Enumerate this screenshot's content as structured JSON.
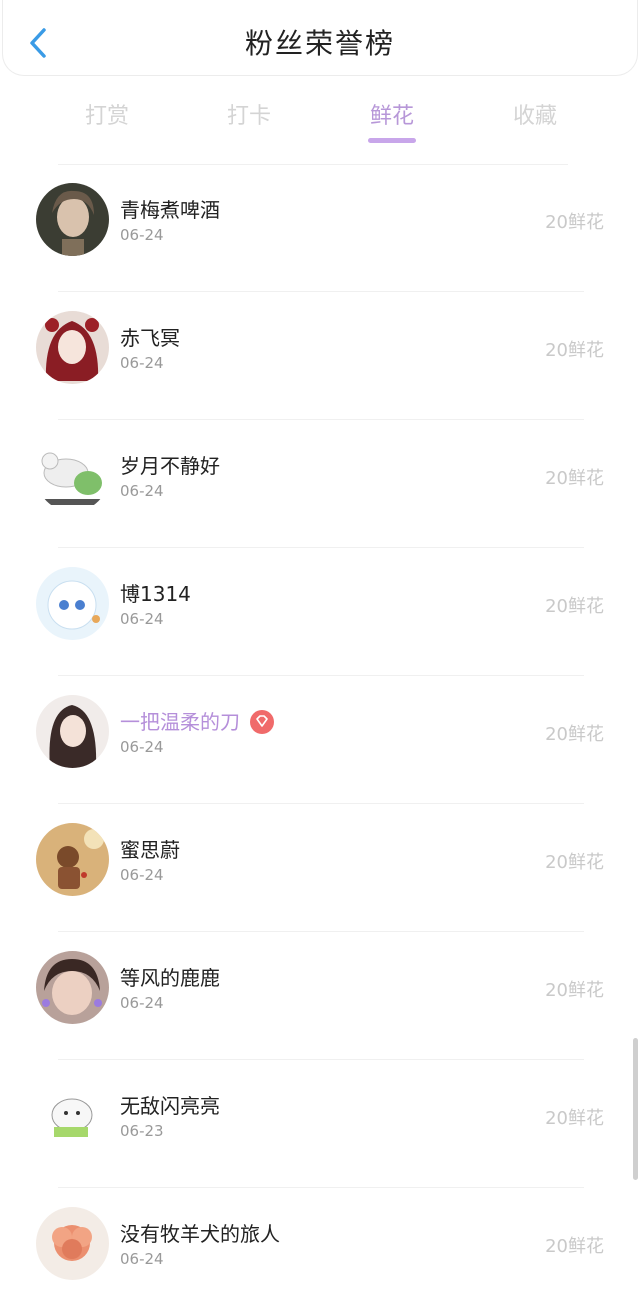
{
  "header": {
    "title": "粉丝荣誉榜"
  },
  "tabs": [
    {
      "label": "打赏"
    },
    {
      "label": "打卡"
    },
    {
      "label": "鲜花"
    },
    {
      "label": "收藏"
    }
  ],
  "active_tab": "鲜花",
  "colors": {
    "accent": "#c8a6ea",
    "back_icon": "#3a9be6",
    "vip_badge": "#f06a6a"
  },
  "fans": [
    {
      "name": "青梅煮啤酒",
      "date": "06-24",
      "count": "20鲜花",
      "vip": false
    },
    {
      "name": "赤飞冥",
      "date": "06-24",
      "count": "20鲜花",
      "vip": false
    },
    {
      "name": "岁月不静好",
      "date": "06-24",
      "count": "20鲜花",
      "vip": false
    },
    {
      "name": "博1314",
      "date": "06-24",
      "count": "20鲜花",
      "vip": false
    },
    {
      "name": "一把温柔的刀",
      "date": "06-24",
      "count": "20鲜花",
      "vip": true
    },
    {
      "name": "蜜思蔚",
      "date": "06-24",
      "count": "20鲜花",
      "vip": false
    },
    {
      "name": "等风的鹿鹿",
      "date": "06-24",
      "count": "20鲜花",
      "vip": false
    },
    {
      "name": "无敌闪亮亮",
      "date": "06-23",
      "count": "20鲜花",
      "vip": false
    },
    {
      "name": "没有牧羊犬的旅人",
      "date": "06-24",
      "count": "20鲜花",
      "vip": false
    }
  ]
}
